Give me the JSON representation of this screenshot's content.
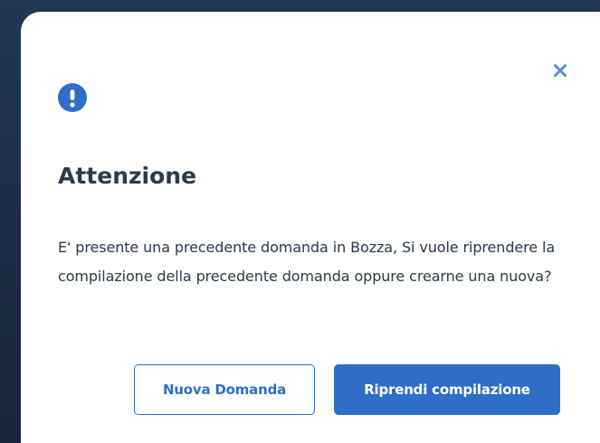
{
  "dialog": {
    "title": "Attenzione",
    "message": "E' presente una precedente domanda in Bozza, Si vuole riprendere la compilazione della precedente domanda oppure crearne una nuova?",
    "alert_icon": "exclamation-circle-icon",
    "close_icon": "close-icon",
    "secondary_button_label": "Nuova Domanda",
    "primary_button_label": "Riprendi compilazione"
  },
  "colors": {
    "accent": "#2f6ec8",
    "close_icon": "#5b8fd6",
    "text": "#2c3a4b",
    "backdrop": "#1f2f45"
  }
}
